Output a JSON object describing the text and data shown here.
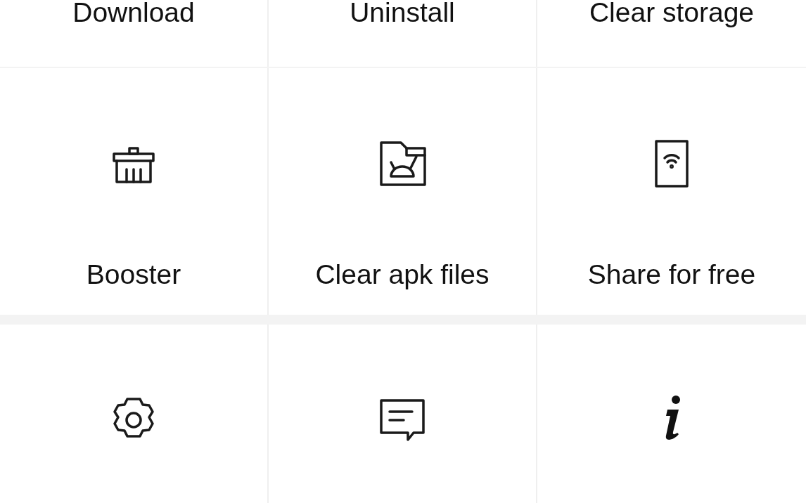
{
  "sections": [
    {
      "kind": "text_row",
      "items": [
        {
          "label": "Download"
        },
        {
          "label": "Uninstall"
        },
        {
          "label": "Clear storage"
        }
      ]
    },
    {
      "kind": "icon_row",
      "items": [
        {
          "label": "Booster"
        },
        {
          "label": "Clear apk files"
        },
        {
          "label": "Share for free"
        }
      ]
    },
    {
      "kind": "icon_row"
    }
  ]
}
